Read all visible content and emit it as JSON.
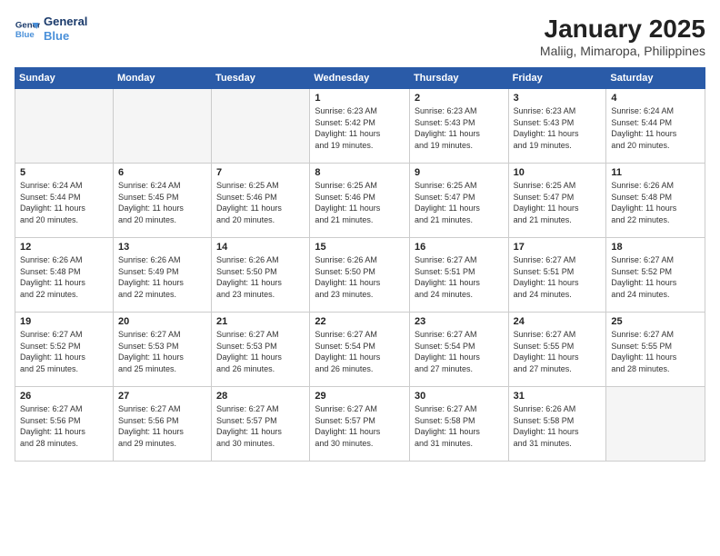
{
  "header": {
    "logo_line1": "General",
    "logo_line2": "Blue",
    "month": "January 2025",
    "location": "Maliig, Mimaropa, Philippines"
  },
  "weekdays": [
    "Sunday",
    "Monday",
    "Tuesday",
    "Wednesday",
    "Thursday",
    "Friday",
    "Saturday"
  ],
  "weeks": [
    [
      {
        "day": "",
        "info": ""
      },
      {
        "day": "",
        "info": ""
      },
      {
        "day": "",
        "info": ""
      },
      {
        "day": "1",
        "info": "Sunrise: 6:23 AM\nSunset: 5:42 PM\nDaylight: 11 hours\nand 19 minutes."
      },
      {
        "day": "2",
        "info": "Sunrise: 6:23 AM\nSunset: 5:43 PM\nDaylight: 11 hours\nand 19 minutes."
      },
      {
        "day": "3",
        "info": "Sunrise: 6:23 AM\nSunset: 5:43 PM\nDaylight: 11 hours\nand 19 minutes."
      },
      {
        "day": "4",
        "info": "Sunrise: 6:24 AM\nSunset: 5:44 PM\nDaylight: 11 hours\nand 20 minutes."
      }
    ],
    [
      {
        "day": "5",
        "info": "Sunrise: 6:24 AM\nSunset: 5:44 PM\nDaylight: 11 hours\nand 20 minutes."
      },
      {
        "day": "6",
        "info": "Sunrise: 6:24 AM\nSunset: 5:45 PM\nDaylight: 11 hours\nand 20 minutes."
      },
      {
        "day": "7",
        "info": "Sunrise: 6:25 AM\nSunset: 5:46 PM\nDaylight: 11 hours\nand 20 minutes."
      },
      {
        "day": "8",
        "info": "Sunrise: 6:25 AM\nSunset: 5:46 PM\nDaylight: 11 hours\nand 21 minutes."
      },
      {
        "day": "9",
        "info": "Sunrise: 6:25 AM\nSunset: 5:47 PM\nDaylight: 11 hours\nand 21 minutes."
      },
      {
        "day": "10",
        "info": "Sunrise: 6:25 AM\nSunset: 5:47 PM\nDaylight: 11 hours\nand 21 minutes."
      },
      {
        "day": "11",
        "info": "Sunrise: 6:26 AM\nSunset: 5:48 PM\nDaylight: 11 hours\nand 22 minutes."
      }
    ],
    [
      {
        "day": "12",
        "info": "Sunrise: 6:26 AM\nSunset: 5:48 PM\nDaylight: 11 hours\nand 22 minutes."
      },
      {
        "day": "13",
        "info": "Sunrise: 6:26 AM\nSunset: 5:49 PM\nDaylight: 11 hours\nand 22 minutes."
      },
      {
        "day": "14",
        "info": "Sunrise: 6:26 AM\nSunset: 5:50 PM\nDaylight: 11 hours\nand 23 minutes."
      },
      {
        "day": "15",
        "info": "Sunrise: 6:26 AM\nSunset: 5:50 PM\nDaylight: 11 hours\nand 23 minutes."
      },
      {
        "day": "16",
        "info": "Sunrise: 6:27 AM\nSunset: 5:51 PM\nDaylight: 11 hours\nand 24 minutes."
      },
      {
        "day": "17",
        "info": "Sunrise: 6:27 AM\nSunset: 5:51 PM\nDaylight: 11 hours\nand 24 minutes."
      },
      {
        "day": "18",
        "info": "Sunrise: 6:27 AM\nSunset: 5:52 PM\nDaylight: 11 hours\nand 24 minutes."
      }
    ],
    [
      {
        "day": "19",
        "info": "Sunrise: 6:27 AM\nSunset: 5:52 PM\nDaylight: 11 hours\nand 25 minutes."
      },
      {
        "day": "20",
        "info": "Sunrise: 6:27 AM\nSunset: 5:53 PM\nDaylight: 11 hours\nand 25 minutes."
      },
      {
        "day": "21",
        "info": "Sunrise: 6:27 AM\nSunset: 5:53 PM\nDaylight: 11 hours\nand 26 minutes."
      },
      {
        "day": "22",
        "info": "Sunrise: 6:27 AM\nSunset: 5:54 PM\nDaylight: 11 hours\nand 26 minutes."
      },
      {
        "day": "23",
        "info": "Sunrise: 6:27 AM\nSunset: 5:54 PM\nDaylight: 11 hours\nand 27 minutes."
      },
      {
        "day": "24",
        "info": "Sunrise: 6:27 AM\nSunset: 5:55 PM\nDaylight: 11 hours\nand 27 minutes."
      },
      {
        "day": "25",
        "info": "Sunrise: 6:27 AM\nSunset: 5:55 PM\nDaylight: 11 hours\nand 28 minutes."
      }
    ],
    [
      {
        "day": "26",
        "info": "Sunrise: 6:27 AM\nSunset: 5:56 PM\nDaylight: 11 hours\nand 28 minutes."
      },
      {
        "day": "27",
        "info": "Sunrise: 6:27 AM\nSunset: 5:56 PM\nDaylight: 11 hours\nand 29 minutes."
      },
      {
        "day": "28",
        "info": "Sunrise: 6:27 AM\nSunset: 5:57 PM\nDaylight: 11 hours\nand 30 minutes."
      },
      {
        "day": "29",
        "info": "Sunrise: 6:27 AM\nSunset: 5:57 PM\nDaylight: 11 hours\nand 30 minutes."
      },
      {
        "day": "30",
        "info": "Sunrise: 6:27 AM\nSunset: 5:58 PM\nDaylight: 11 hours\nand 31 minutes."
      },
      {
        "day": "31",
        "info": "Sunrise: 6:26 AM\nSunset: 5:58 PM\nDaylight: 11 hours\nand 31 minutes."
      },
      {
        "day": "",
        "info": ""
      }
    ]
  ]
}
